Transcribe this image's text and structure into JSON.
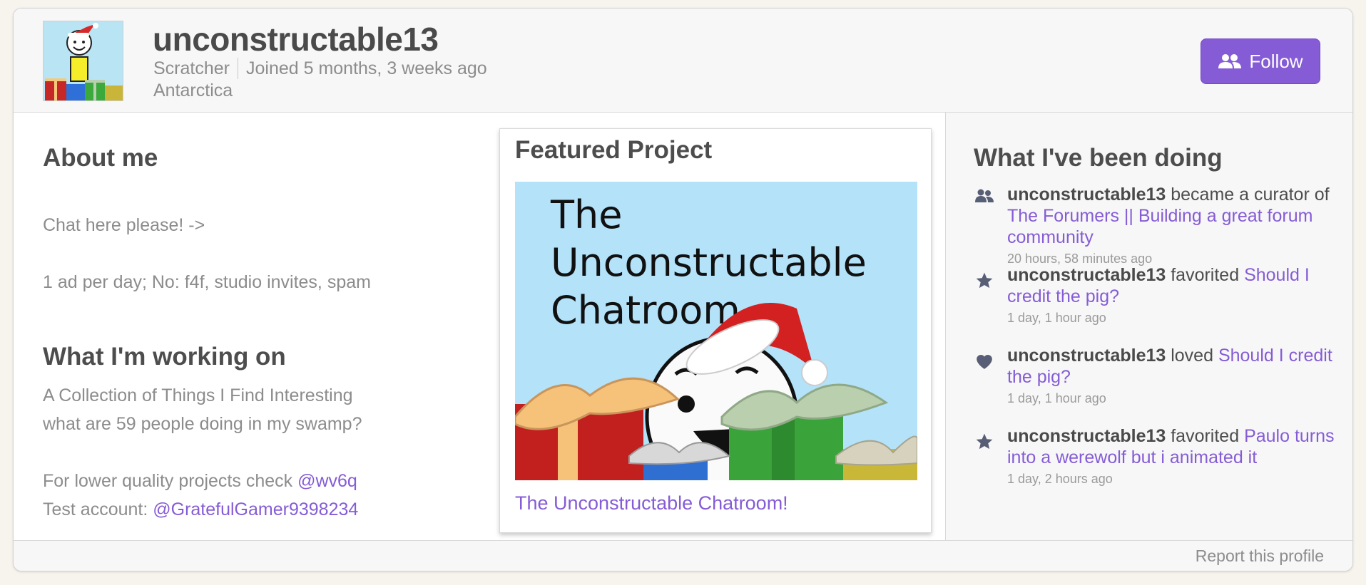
{
  "profile": {
    "username": "unconstructable13",
    "role": "Scratcher",
    "joined": "Joined 5 months, 3 weeks ago",
    "location": "Antarctica",
    "follow_label": "Follow"
  },
  "about": {
    "title": "About me",
    "lines": [
      "Chat here please! ->",
      "1 ad per day; No: f4f, studio invites, spam"
    ]
  },
  "working": {
    "title": "What I'm working on",
    "line1": "A Collection of Things I Find Interesting",
    "line2": "what are 59 people doing in my swamp?",
    "line3_prefix": "For lower quality projects check ",
    "line3_link": "@wv6q",
    "line4_prefix": "Test account: ",
    "line4_link": "@GratefulGamer9398234"
  },
  "featured": {
    "title": "Featured Project",
    "thumb_text": [
      "The",
      "Unconstructable",
      "Chatroom"
    ],
    "project_title": "The Unconstructable Chatroom!"
  },
  "activity": {
    "title": "What I've been doing",
    "items": [
      {
        "icon": "curator-icon",
        "user": "unconstructable13",
        "verb": " became a curator of ",
        "target": "The Forumers || Building a great forum community",
        "time": "20 hours, 58 minutes ago"
      },
      {
        "icon": "star-icon",
        "user": "unconstructable13",
        "verb": " favorited ",
        "target": "Should I credit the pig?",
        "time": "1 day, 1 hour ago"
      },
      {
        "icon": "heart-icon",
        "user": "unconstructable13",
        "verb": " loved ",
        "target": "Should I credit the pig?",
        "time": "1 day, 1 hour ago"
      },
      {
        "icon": "star-icon",
        "user": "unconstructable13",
        "verb": " favorited ",
        "target": "Paulo turns into a werewolf but i animated it",
        "time": "1 day, 2 hours ago"
      }
    ]
  },
  "footer": {
    "report_label": "Report this profile"
  },
  "colors": {
    "accent": "#855cd6",
    "text_dark": "#4d4d4d",
    "text_muted": "#8c8c8c"
  }
}
